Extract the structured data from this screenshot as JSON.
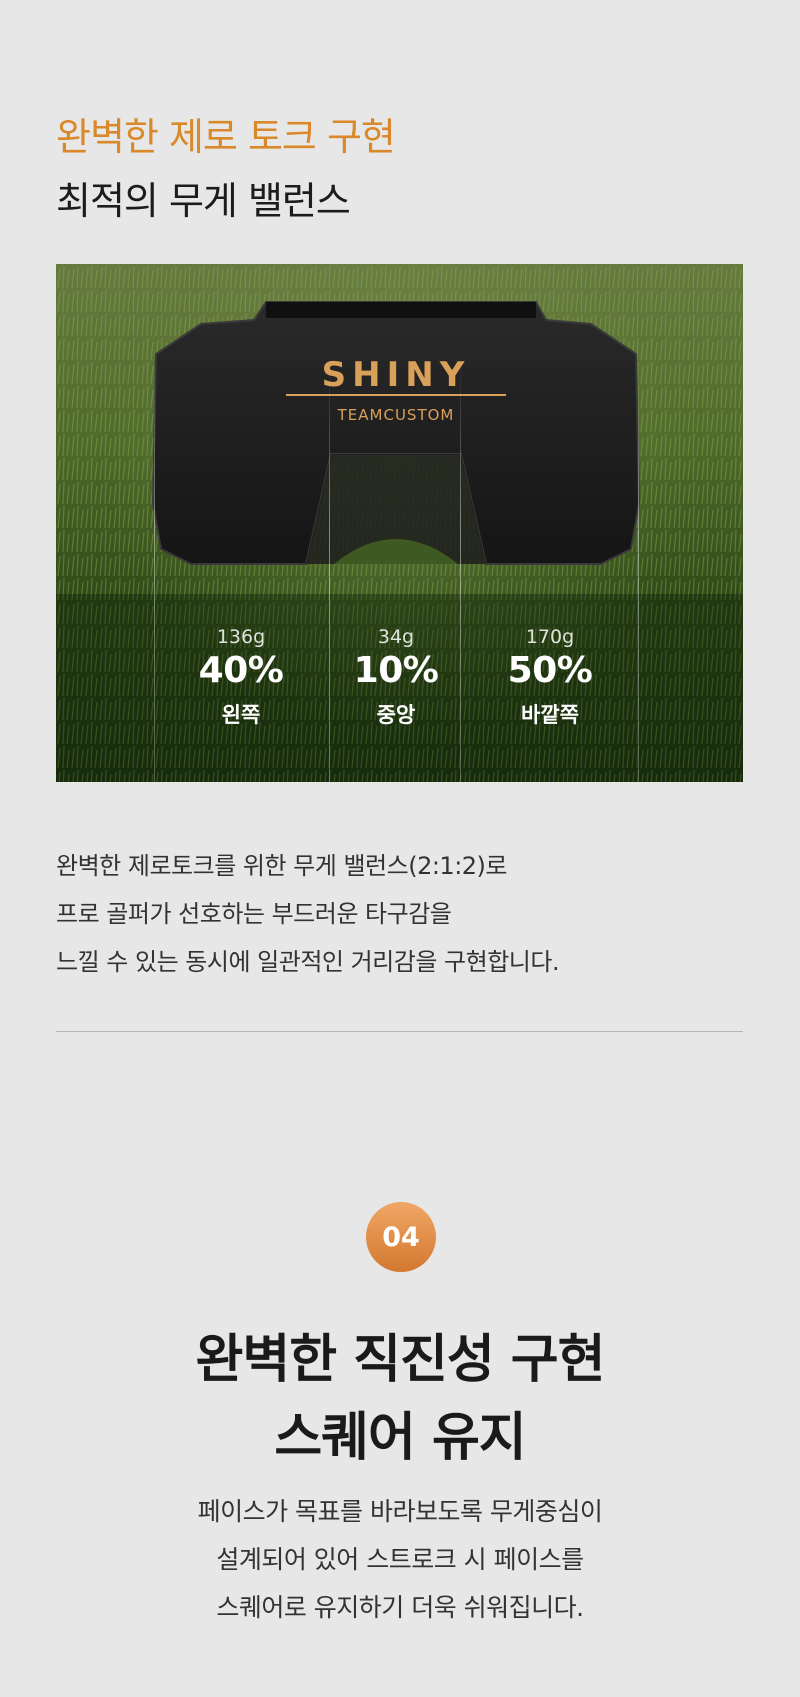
{
  "section1": {
    "title": "완벽한 제로 토크 구현",
    "subtitle": "최적의 무게 밸런스"
  },
  "product": {
    "brand": "SHINY",
    "sub_brand": "TEAMCUSTOM",
    "brand_color": "#d9a05a"
  },
  "stats": [
    {
      "weight": "136g",
      "percent": "40%",
      "position": "왼쪽"
    },
    {
      "weight": "34g",
      "percent": "10%",
      "position": "중앙"
    },
    {
      "weight": "170g",
      "percent": "50%",
      "position": "바깥쪽"
    }
  ],
  "description1": [
    "완벽한 제로토크를 위한 무게 밸런스(2:1:2)로",
    "프로 골퍼가 선호하는 부드러운 타구감을",
    "느낄 수 있는 동시에 일관적인 거리감을 구현합니다."
  ],
  "section2": {
    "step": "04",
    "title_lines": [
      "완벽한 직진성 구현",
      "스퀘어 유지"
    ],
    "description": [
      "페이스가 목표를 바라보도록 무게중심이",
      "설계되어 있어 스트로크 시 페이스를",
      "스퀘어로 유지하기 더욱 쉬워집니다."
    ]
  },
  "colors": {
    "accent": "#d9892a",
    "badge": "#e08f45",
    "background": "#e7e7e7"
  }
}
